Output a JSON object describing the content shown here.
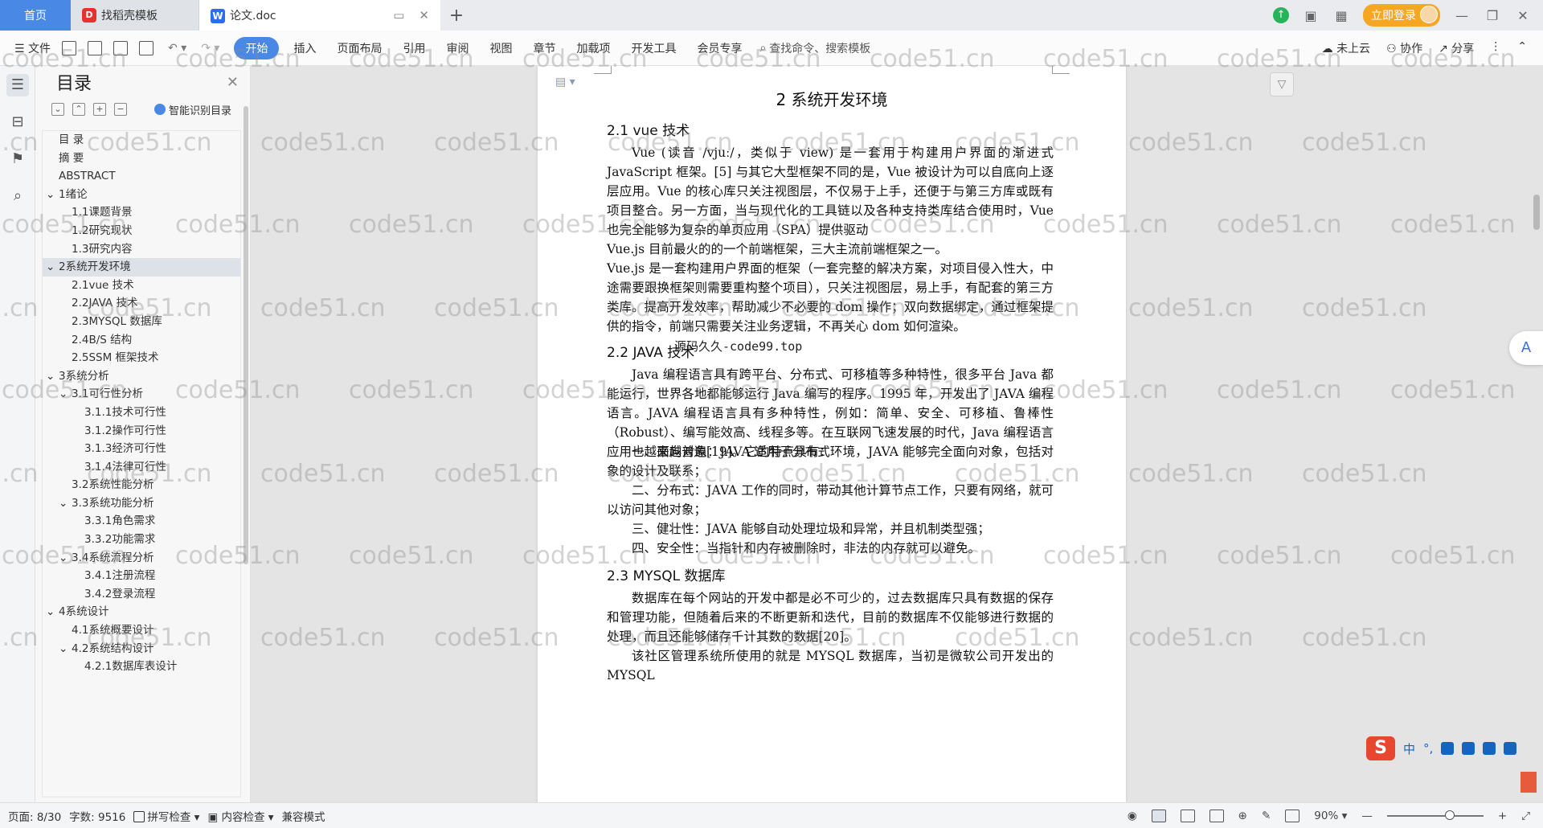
{
  "titlebar": {
    "home_tab": "首页",
    "template_tab": "找稻壳模板",
    "doc_tab": "论文.doc",
    "new_tab": "+",
    "login": "立即登录"
  },
  "ribbon": {
    "file": "文件",
    "tabs": [
      "开始",
      "插入",
      "页面布局",
      "引用",
      "审阅",
      "视图",
      "章节",
      "加载项",
      "开发工具",
      "会员专享"
    ],
    "search": "查找命令、搜索模板",
    "cloud": "未上云",
    "collab": "协作",
    "share": "分享"
  },
  "toc": {
    "title": "目录",
    "smart": "智能识别目录",
    "items": [
      {
        "label": "目  录",
        "level": 0
      },
      {
        "label": "摘  要",
        "level": 0
      },
      {
        "label": "ABSTRACT",
        "level": 0
      },
      {
        "label": "1绪论",
        "level": 0,
        "caret": true
      },
      {
        "label": "1.1课题背景",
        "level": 1
      },
      {
        "label": "1.2研究现状",
        "level": 1
      },
      {
        "label": "1.3研究内容",
        "level": 1
      },
      {
        "label": "2系统开发环境",
        "level": 0,
        "caret": true,
        "selected": true
      },
      {
        "label": "2.1vue 技术",
        "level": 1
      },
      {
        "label": "2.2JAVA 技术",
        "level": 1
      },
      {
        "label": "2.3MYSQL 数据库",
        "level": 1
      },
      {
        "label": "2.4B/S 结构",
        "level": 1
      },
      {
        "label": "2.5SSM 框架技术",
        "level": 1
      },
      {
        "label": "3系统分析",
        "level": 0,
        "caret": true
      },
      {
        "label": "3.1可行性分析",
        "level": 1,
        "caret": true
      },
      {
        "label": "3.1.1技术可行性",
        "level": 2
      },
      {
        "label": "3.1.2操作可行性",
        "level": 2
      },
      {
        "label": "3.1.3经济可行性",
        "level": 2
      },
      {
        "label": "3.1.4法律可行性",
        "level": 2
      },
      {
        "label": "3.2系统性能分析",
        "level": 1
      },
      {
        "label": "3.3系统功能分析",
        "level": 1,
        "caret": true
      },
      {
        "label": "3.3.1角色需求",
        "level": 2
      },
      {
        "label": "3.3.2功能需求",
        "level": 2
      },
      {
        "label": "3.4系统流程分析",
        "level": 1,
        "caret": true
      },
      {
        "label": "3.4.1注册流程",
        "level": 2
      },
      {
        "label": "3.4.2登录流程",
        "level": 2
      },
      {
        "label": "4系统设计",
        "level": 0,
        "caret": true
      },
      {
        "label": "4.1系统概要设计",
        "level": 1
      },
      {
        "label": "4.2系统结构设计",
        "level": 1,
        "caret": true
      },
      {
        "label": "4.2.1数据库表设计",
        "level": 2
      }
    ]
  },
  "doc": {
    "chapter": "2  系统开发环境",
    "s21": "2.1  vue 技术",
    "p1": "Vue (读音  /vjuː/，类似于  view) 是一套用于构建用户界面的渐进式 JavaScript 框架。[5] 与其它大型框架不同的是，Vue 被设计为可以自底向上逐层应用。Vue 的核心库只关注视图层，不仅易于上手，还便于与第三方库或既有项目整合。另一方面，当与现代化的工具链以及各种支持类库结合使用时，Vue 也完全能够为复杂的单页应用（SPA）提供驱动",
    "p2": "Vue.js 目前最火的的一个前端框架，三大主流前端框架之一。",
    "p3": "Vue.js 是一套构建用户界面的框架（一套完整的解决方案，对项目侵入性大，中途需要跟换框架则需要重构整个项目），只关注视图层，易上手，有配套的第三方类库。提高开发效率，帮助减少不必要的 dom 操作；双向数据绑定，通过框架提供的指令，前端只需要关注业务逻辑，不再关心 dom 如何渲染。",
    "s22": "2.2  JAVA 技术",
    "overlay": "源码久久-code99.top",
    "p4": "Java 编程语言具有跨平台、分布式、可移植等多种特性，很多平台 Java 都能运行，世界各地都能够运行 Java 编写的程序。1995 年，开发出了 JAVA 编程语言。JAVA 编程语言具有多种特性，例如：简单、安全、可移植、鲁棒性（Robust）、编写能效高、线程多等。在互联网飞速发展的时代，Java 编程语言应用也越来越普遍[19]。它的特点具有：",
    "p5": "一、面向对象：JAVA 适用于分布式环境，JAVA 能够完全面向对象，包括对象的设计及联系；",
    "p6": "二、分布式：JAVA 工作的同时，带动其他计算节点工作，只要有网络，就可以访问其他对象；",
    "p7": "三、健壮性：JAVA 能够自动处理垃圾和异常，并且机制类型强；",
    "p8": "四、安全性：当指针和内存被删除时，非法的内存就可以避免。",
    "s23": "2.3  MYSQL 数据库",
    "p9": "数据库在每个网站的开发中都是必不可少的，过去数据库只具有数据的保存和管理功能，但随着后来的不断更新和迭代，目前的数据库不仅能够进行数据的处理，而且还能够储存千计其数的数据[20]。",
    "p10": "该社区管理系统所使用的就是 MYSQL 数据库，当初是微软公司开发出的 MYSQL"
  },
  "ime": {
    "lang": "中"
  },
  "status": {
    "page": "页面: 8/30",
    "words": "字数: 9516",
    "spell": "拼写检查",
    "content": "内容检查",
    "compat": "兼容模式",
    "zoom": "90%"
  },
  "watermark_text": "code51.cn"
}
